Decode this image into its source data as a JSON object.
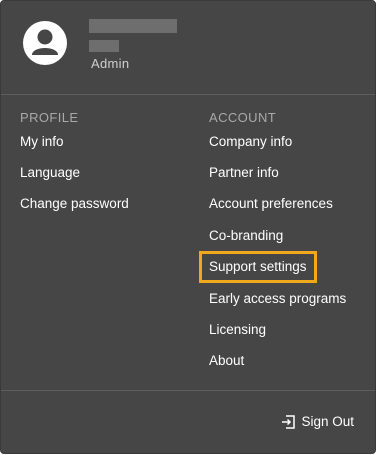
{
  "user": {
    "role": "Admin"
  },
  "profile": {
    "heading": "PROFILE",
    "items": [
      "My info",
      "Language",
      "Change password"
    ]
  },
  "account": {
    "heading": "ACCOUNT",
    "items": [
      "Company info",
      "Partner info",
      "Account preferences",
      "Co-branding",
      "Support settings",
      "Early access programs",
      "Licensing",
      "About"
    ]
  },
  "footer": {
    "signout_label": "Sign Out"
  },
  "colors": {
    "panel_bg": "#464646",
    "highlight": "#f0a81c",
    "heading_text": "#a9a9a9"
  },
  "icons": {
    "avatar": "user-avatar-icon",
    "signout": "sign-out-icon"
  }
}
